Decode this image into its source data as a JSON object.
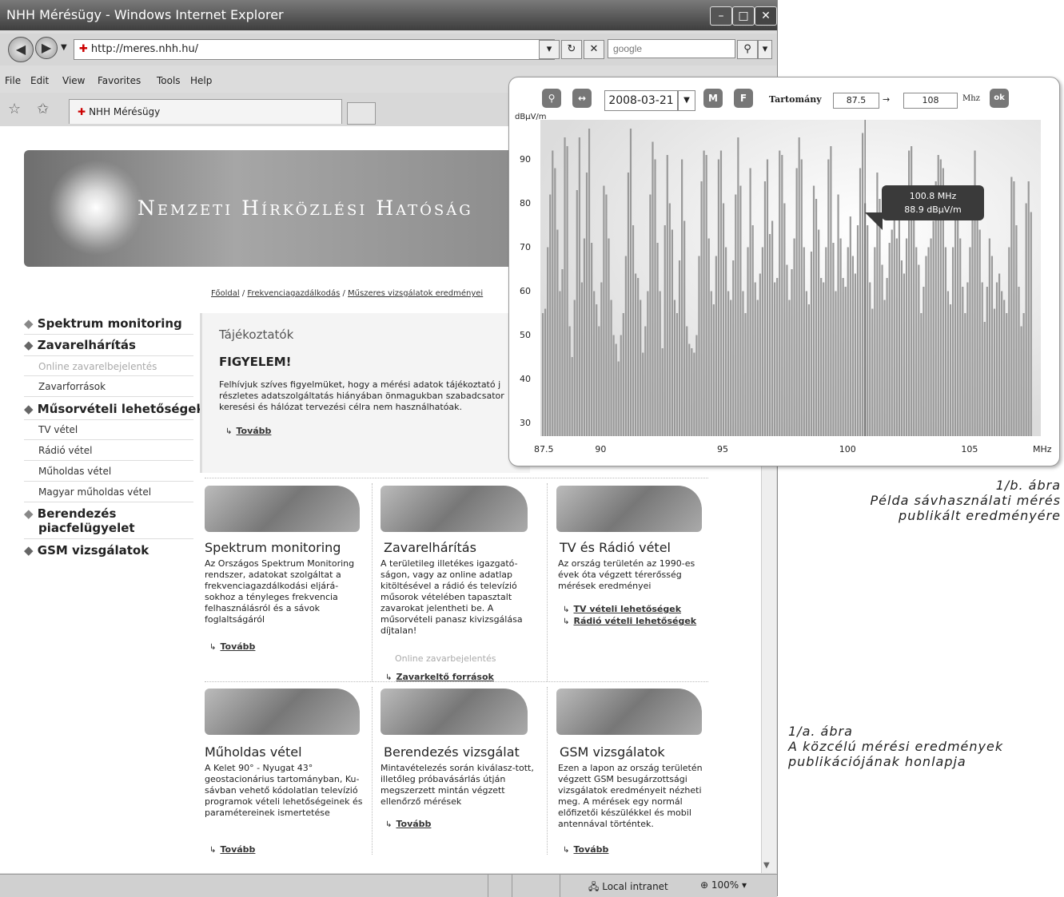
{
  "window": {
    "title": "NHH Mérésügy - Windows Internet Explorer",
    "min_label": "–",
    "max_label": "□",
    "close_label": "✕",
    "address": "http://meres.nhh.hu/",
    "search_placeholder": "google",
    "tab_title": "NHH Mérésügy",
    "menu": [
      "File",
      "Edit",
      "View",
      "Favorites",
      "Tools",
      "Help"
    ],
    "status_zone": "Local intranet",
    "zoom": "100%"
  },
  "page": {
    "banner_title": "Nemzeti Hírközlési Hatóság",
    "breadcrumb": [
      "Főoldal",
      "Frekvenciagazdálkodás",
      "Műszeres vizsgálatok eredményei"
    ],
    "sidebar": [
      {
        "label": "Spektrum monitoring",
        "type": "main"
      },
      {
        "label": "Zavarelhárítás",
        "type": "main"
      },
      {
        "label": "Online zavarelbejelentés",
        "type": "muted"
      },
      {
        "label": "Zavarforrások",
        "type": "sub"
      },
      {
        "label": "Műsorvételi lehetőségek",
        "type": "main"
      },
      {
        "label": "TV vétel",
        "type": "sub"
      },
      {
        "label": "Rádió vétel",
        "type": "sub"
      },
      {
        "label": "Műholdas vétel",
        "type": "sub"
      },
      {
        "label": "Magyar műholdas vétel",
        "type": "sub"
      },
      {
        "label": "Berendezés",
        "type": "main"
      },
      {
        "label": "piacfelügyelet",
        "type": "main2"
      },
      {
        "label": "GSM vizsgálatok",
        "type": "main"
      }
    ],
    "info": {
      "heading": "Tájékoztatók",
      "warning": "FIGYELEM!",
      "text": "Felhívjuk szíves figyelmüket, hogy a mérési adatok tájékoztató j részletes adatszolgáltatás hiányában önmagukban szabadcsator keresési és hálózat tervezési célra nem használhatóak.",
      "more": "Tovább"
    },
    "cards": [
      {
        "title": "Spektrum monitoring",
        "text": "Az Országos Spektrum Monitoring rendszer, adatokat szolgáltat a frekvenciagazdálkodási eljárá-sokhoz a tényleges frekvencia felhasználásról és a sávok foglaltságáról",
        "links": [
          "Tovább"
        ],
        "muted": ""
      },
      {
        "title": "Zavarelhárítás",
        "text": "A területileg illetékes igazgató-ságon, vagy az online adatlap kitöltésével a rádió és televízió műsorok vételében tapasztalt zavarokat jelentheti be. A műsorvételi panasz kivizsgálása díjtalan!",
        "links": [
          "Zavarkeltő források"
        ],
        "muted": "Online zavarbejelentés"
      },
      {
        "title": "TV és Rádió vétel",
        "text": "Az ország területén az 1990-es évek óta végzett térerősség mérések eredményei",
        "links": [
          "TV vételi lehetőségek",
          "Rádió vételi lehetőségek"
        ],
        "muted": ""
      },
      {
        "title": "Műholdas vétel",
        "text": "A Kelet 90° - Nyugat 43° geostacionárius tartományban, Ku-sávban vehető kódolatlan televízió programok vételi lehetőségeinek és paramétereinek ismertetése",
        "links": [
          "Tovább"
        ],
        "muted": ""
      },
      {
        "title": "Berendezés vizsgálat",
        "text": "Mintavételezés során kiválasz-tott, illetőleg próbavásárlás útján megszerzett mintán végzett ellenőrző mérések",
        "links": [
          "Tovább"
        ],
        "muted": ""
      },
      {
        "title": "GSM vizsgálatok",
        "text": "Ezen a lapon az ország területén végzett GSM besugárzottsági vizsgálatok eredményeit nézheti meg. A mérések egy normál előfizetői készülékkel és mobil antennával történtek.",
        "links": [
          "Tovább"
        ],
        "muted": ""
      }
    ]
  },
  "chart_panel": {
    "btn_m": "M",
    "btn_f": "F",
    "btn_ok": "ok",
    "date": "2008-03-21",
    "range_label": "Tartomány",
    "range_from": "87.5",
    "range_arrow": "→",
    "range_to": "108",
    "range_unit": "Mhz",
    "tooltip_line1": "100.8 MHz",
    "tooltip_line2": "88.9 dBµV/m"
  },
  "chart_data": {
    "type": "bar",
    "ylabel": "dBµV/m",
    "xlabel": "MHz",
    "xlim": [
      87.5,
      108
    ],
    "ylim": [
      27,
      99
    ],
    "yticks": [
      30,
      40,
      50,
      60,
      70,
      80,
      90
    ],
    "xticks": [
      87.5,
      90,
      95,
      100,
      105
    ],
    "highlight": {
      "x": 100.8,
      "y": 88.9
    },
    "x_start": 87.6,
    "x_step": 0.1,
    "values": [
      55,
      56,
      70,
      82,
      92,
      88,
      74,
      60,
      65,
      95,
      93,
      52,
      45,
      58,
      83,
      95,
      62,
      72,
      87,
      97,
      71,
      60,
      57,
      52,
      62,
      84,
      82,
      72,
      58,
      50,
      48,
      44,
      50,
      55,
      68,
      87,
      97,
      75,
      64,
      63,
      58,
      46,
      52,
      60,
      82,
      94,
      90,
      71,
      60,
      47,
      75,
      91,
      80,
      74,
      58,
      55,
      67,
      90,
      76,
      52,
      48,
      47,
      46,
      50,
      68,
      85,
      92,
      91,
      72,
      60,
      57,
      68,
      90,
      92,
      80,
      70,
      60,
      58,
      67,
      82,
      95,
      84,
      60,
      55,
      70,
      88,
      75,
      62,
      58,
      64,
      70,
      85,
      90,
      73,
      76,
      62,
      63,
      92,
      91,
      80,
      66,
      58,
      65,
      72,
      88,
      95,
      90,
      70,
      60,
      57,
      69,
      84,
      81,
      74,
      63,
      62,
      70,
      90,
      93,
      71,
      60,
      82,
      72,
      63,
      61,
      70,
      77,
      68,
      64,
      75,
      88,
      96,
      80,
      75,
      62,
      56,
      70,
      87,
      81,
      66,
      58,
      63,
      71,
      74,
      84,
      72,
      78,
      67,
      64,
      72,
      92,
      93,
      84,
      70,
      66,
      55,
      61,
      68,
      70,
      72,
      76,
      85,
      91,
      90,
      88,
      70,
      60,
      57,
      70,
      84,
      80,
      72,
      61,
      55,
      62,
      70,
      80,
      92,
      84,
      74,
      62,
      53,
      61,
      72,
      68,
      56,
      62,
      64,
      60,
      58,
      55,
      70,
      86,
      85,
      75,
      61,
      52,
      55,
      80,
      85,
      78
    ]
  },
  "captions": {
    "b_title": "1/b. ábra",
    "b_line1": "Példa sávhasználati mérés",
    "b_line2": "publikált eredményére",
    "a_title": "1/a. ábra",
    "a_line1": "A közcélú mérési eredmények",
    "a_line2": "publikációjának honlapja"
  }
}
